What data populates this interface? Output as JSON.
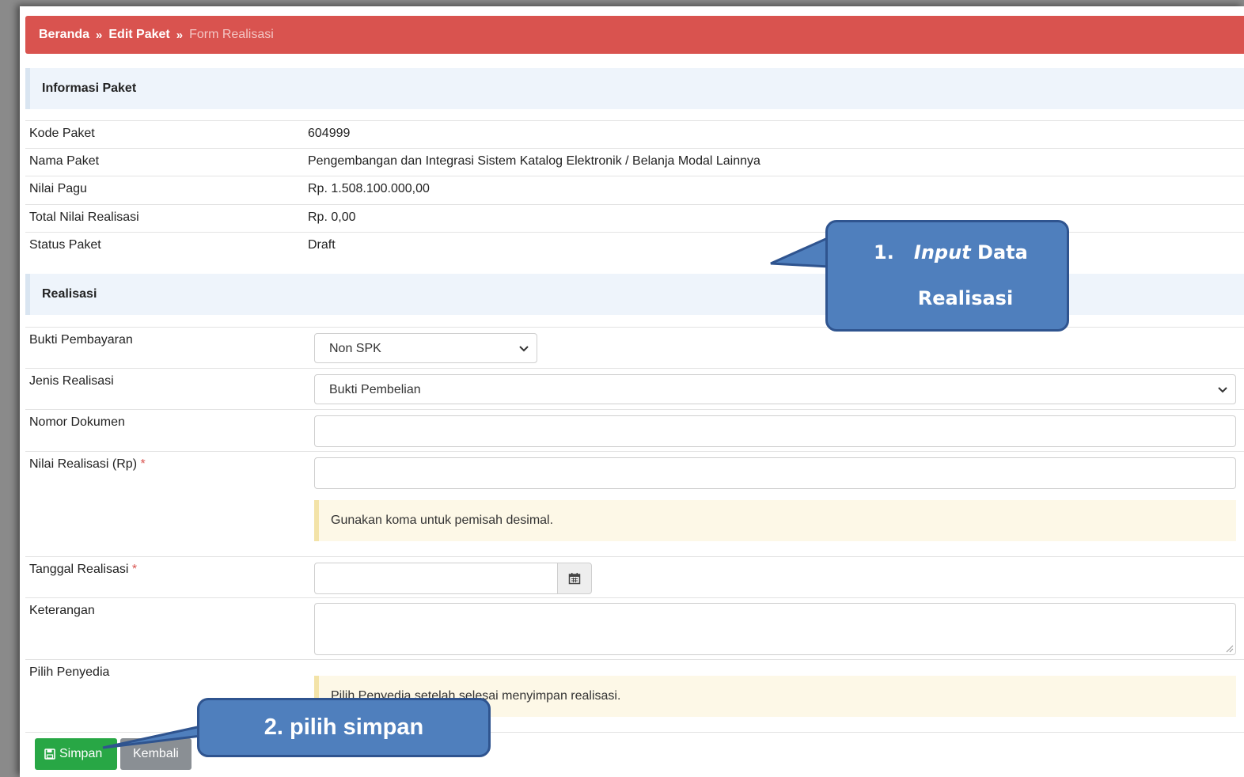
{
  "breadcrumb": {
    "items": [
      "Beranda",
      "Edit Paket",
      "Form Realisasi"
    ],
    "separator": "»"
  },
  "info_section": {
    "title": "Informasi Paket",
    "rows": [
      {
        "label": "Kode Paket",
        "value": "604999"
      },
      {
        "label": "Nama Paket",
        "value": "Pengembangan dan Integrasi Sistem Katalog Elektronik / Belanja Modal Lainnya"
      },
      {
        "label": "Nilai Pagu",
        "value": "Rp. 1.508.100.000,00"
      },
      {
        "label": "Total Nilai Realisasi",
        "value": "Rp. 0,00"
      },
      {
        "label": "Status Paket",
        "value": "Draft"
      }
    ]
  },
  "realisasi_section": {
    "title": "Realisasi",
    "bukti_pembayaran": {
      "label": "Bukti Pembayaran",
      "value": "Non SPK"
    },
    "jenis_realisasi": {
      "label": "Jenis Realisasi",
      "value": "Bukti Pembelian"
    },
    "nomor_dokumen": {
      "label": "Nomor Dokumen",
      "value": ""
    },
    "nilai_realisasi": {
      "label": "Nilai Realisasi (Rp)",
      "required_mark": "*",
      "value": "",
      "hint": "Gunakan koma untuk pemisah desimal."
    },
    "tanggal_realisasi": {
      "label": "Tanggal Realisasi",
      "required_mark": "*",
      "value": ""
    },
    "keterangan": {
      "label": "Keterangan",
      "value": ""
    },
    "pilih_penyedia": {
      "label": "Pilih Penyedia",
      "hint": "Pilih Penyedia setelah selesai menyimpan realisasi."
    }
  },
  "actions": {
    "save_label": "Simpan",
    "back_label": "Kembali"
  },
  "callouts": {
    "first": {
      "number": "1.",
      "emph": "Input",
      "line1_rest": "Data",
      "line2": "Realisasi"
    },
    "second": {
      "text": "2. pilih simpan"
    }
  },
  "colors": {
    "breadcrumb_bg": "#d9534f",
    "section_bg": "#eef4fb",
    "note_bg": "#fdf8e7",
    "save_btn": "#28a745",
    "back_btn": "#8a8f94",
    "callout_fill": "#4f7fbd",
    "callout_border": "#2f548f"
  },
  "icons": {
    "save": "floppy-disk-icon",
    "calendar": "calendar-icon",
    "dropdown": "chevron-down-icon"
  }
}
